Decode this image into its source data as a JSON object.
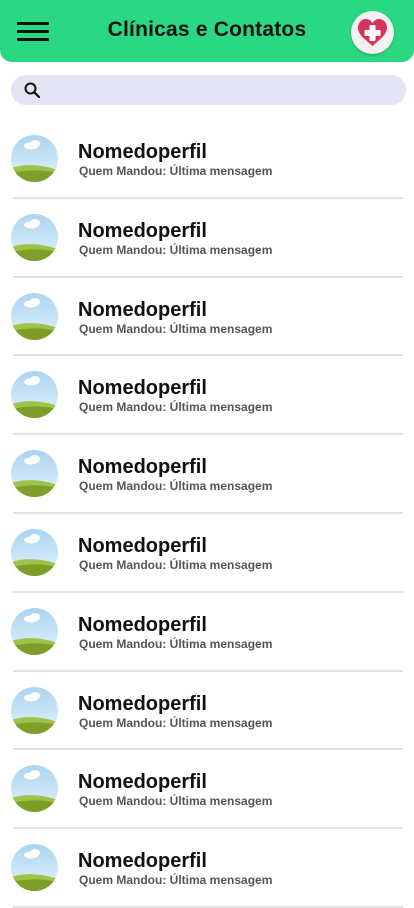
{
  "header": {
    "title": "Clínicas e Contatos",
    "menu_icon": "hamburger-menu-icon",
    "logo_icon": "heart-cross-icon",
    "accent_color": "#2ad783"
  },
  "search": {
    "icon": "search-icon",
    "value": "",
    "placeholder": ""
  },
  "contacts": [
    {
      "name": "Nomedoperfil",
      "last_message": "Quem Mandou: Última mensagem"
    },
    {
      "name": "Nomedoperfil",
      "last_message": "Quem Mandou: Última mensagem"
    },
    {
      "name": "Nomedoperfil",
      "last_message": "Quem Mandou: Última mensagem"
    },
    {
      "name": "Nomedoperfil",
      "last_message": "Quem Mandou: Última mensagem"
    },
    {
      "name": "Nomedoperfil",
      "last_message": "Quem Mandou: Última mensagem"
    },
    {
      "name": "Nomedoperfil",
      "last_message": "Quem Mandou: Última mensagem"
    },
    {
      "name": "Nomedoperfil",
      "last_message": "Quem Mandou: Última mensagem"
    },
    {
      "name": "Nomedoperfil",
      "last_message": "Quem Mandou: Última mensagem"
    },
    {
      "name": "Nomedoperfil",
      "last_message": "Quem Mandou: Última mensagem"
    },
    {
      "name": "Nomedoperfil",
      "last_message": "Quem Mandou: Última mensagem"
    }
  ]
}
